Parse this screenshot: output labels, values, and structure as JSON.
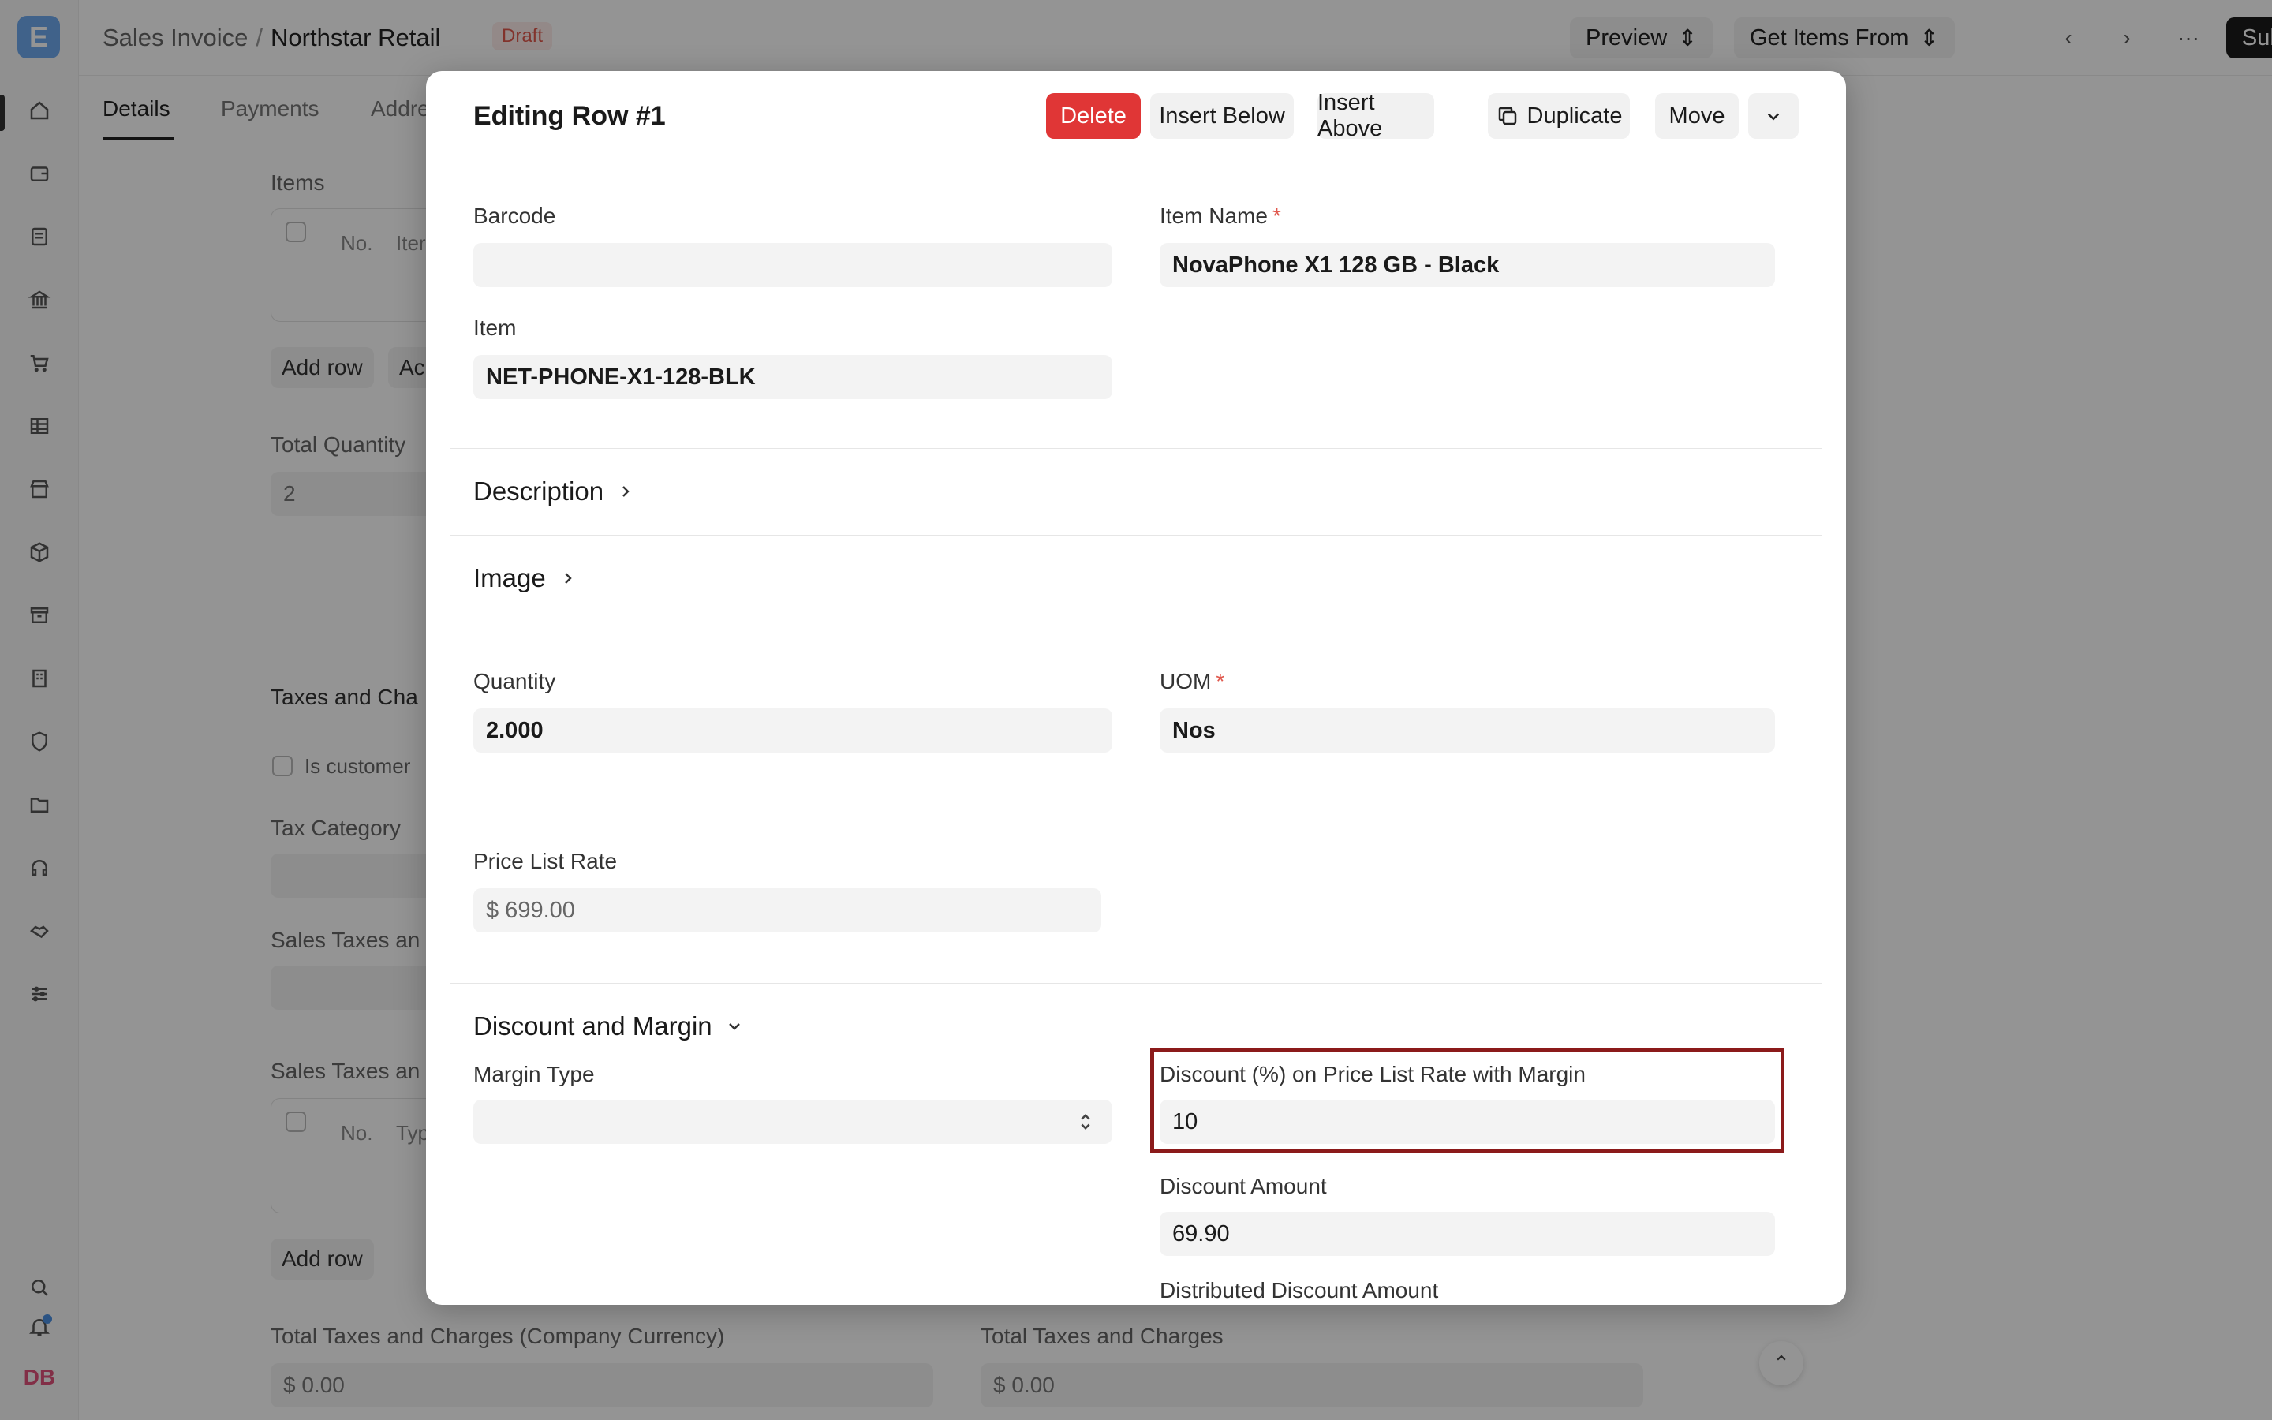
{
  "app": {
    "logo_letter": "E",
    "avatar_initials": "DB"
  },
  "header": {
    "doctype": "Sales Invoice",
    "separator": "/",
    "customer": "Northstar Retail",
    "status": "Draft",
    "preview_label": "Preview",
    "get_items_label": "Get Items From",
    "submit_label": "Submit"
  },
  "tabs": [
    "Details",
    "Payments",
    "Addre"
  ],
  "background_form": {
    "items_label": "Items",
    "col_no": "No.",
    "col_item": "Iter",
    "add_row": "Add row",
    "add_multiple": "Ac",
    "total_qty_label": "Total Quantity",
    "total_qty_value": "2",
    "taxes_section": "Taxes and Cha",
    "is_customer_label": "Is customer",
    "tax_category_label": "Tax Category",
    "sales_taxes_label_1": "Sales Taxes an",
    "sales_taxes_label_2": "Sales Taxes an",
    "col_type": "Typ",
    "add_row_2": "Add row",
    "total_taxes_company_label": "Total Taxes and Charges (Company Currency)",
    "total_taxes_company_value": "$ 0.00",
    "total_taxes_label": "Total Taxes and Charges",
    "total_taxes_value": "$ 0.00"
  },
  "modal": {
    "title": "Editing Row #1",
    "buttons": {
      "delete": "Delete",
      "insert_below": "Insert Below",
      "insert_above": "Insert Above",
      "duplicate": "Duplicate",
      "move": "Move"
    },
    "fields": {
      "barcode_label": "Barcode",
      "barcode_value": "",
      "item_name_label": "Item Name",
      "item_name_value": "NovaPhone X1 128 GB - Black",
      "item_label": "Item",
      "item_value": "NET-PHONE-X1-128-BLK",
      "quantity_label": "Quantity",
      "quantity_value": "2.000",
      "uom_label": "UOM",
      "uom_value": "Nos",
      "price_list_rate_label": "Price List Rate",
      "price_list_rate_value": "$ 699.00",
      "margin_type_label": "Margin Type",
      "margin_type_value": "",
      "discount_pct_label": "Discount (%) on Price List Rate with Margin",
      "discount_pct_value": "10",
      "discount_amount_label": "Discount Amount",
      "discount_amount_value": "69.90",
      "distributed_discount_label": "Distributed Discount Amount"
    },
    "sections": {
      "description": "Description",
      "image": "Image",
      "discount_margin": "Discount and Margin"
    },
    "required_mark": "*"
  },
  "colors": {
    "danger": "#e03636",
    "highlight_border": "#8b1a1a",
    "draft": "#e0584d",
    "logo": "#6ea9ee"
  }
}
